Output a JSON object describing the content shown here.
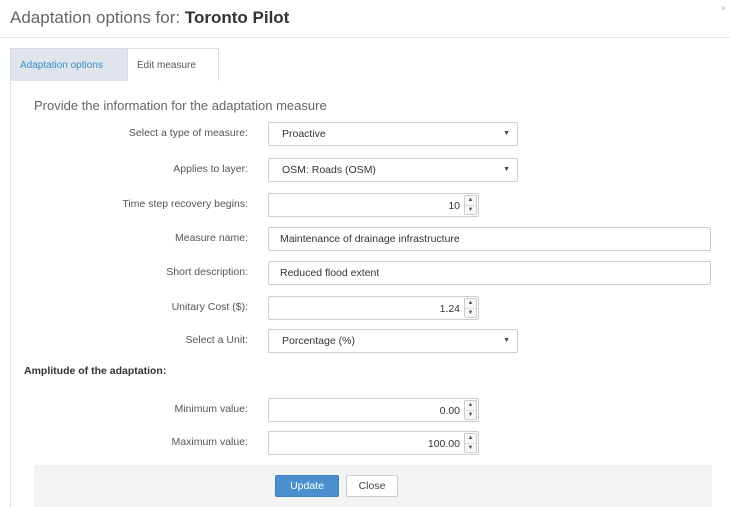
{
  "header": {
    "title_prefix": "Adaptation options for: ",
    "title_project": "Toronto Pilot",
    "close_glyph": "×"
  },
  "tabs": [
    {
      "label": "Adaptation options",
      "active": false
    },
    {
      "label": "Edit measure",
      "active": true
    }
  ],
  "form": {
    "section_title": "Provide the information for the adaptation measure",
    "measure_type": {
      "label": "Select a type of measure:",
      "value": "Proactive"
    },
    "layer": {
      "label": "Applies to layer:",
      "value": "OSM: Roads (OSM)"
    },
    "recovery_step": {
      "label": "Time step recovery begins:",
      "value": "10"
    },
    "measure_name": {
      "label": "Measure name:",
      "value": "Maintenance of drainage infrastructure"
    },
    "short_description": {
      "label": "Short description:",
      "value": "Reduced flood extent"
    },
    "unitary_cost": {
      "label": "Unitary Cost ($):",
      "value": "1.24"
    },
    "unit": {
      "label": "Select a Unit:",
      "value": "Porcentage (%)"
    },
    "amplitude_heading": "Amplitude of the adaptation:",
    "minimum": {
      "label": "Minimum value:",
      "value": "0.00"
    },
    "maximum": {
      "label": "Maximum value:",
      "value": "100.00"
    }
  },
  "footer": {
    "update_label": "Update",
    "close_label": "Close"
  },
  "glyphs": {
    "caret": "▼",
    "spin_up": "▲",
    "spin_down": "▼"
  },
  "colors": {
    "primary": "#4c8fcf",
    "tab_link": "#3b8cc4",
    "tab_inactive_bg": "#dfe5ea"
  }
}
